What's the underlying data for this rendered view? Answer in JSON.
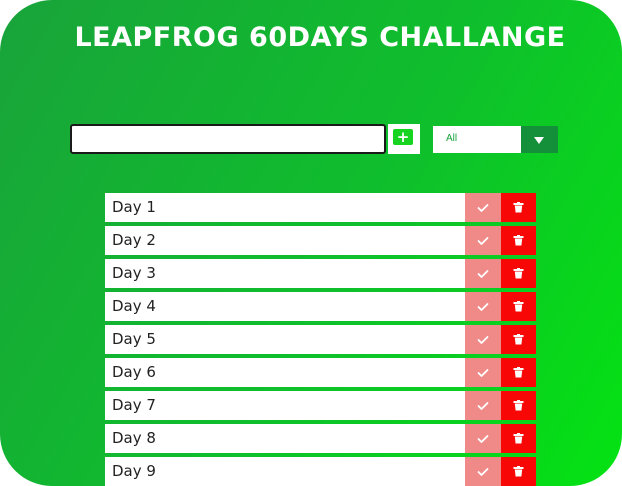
{
  "header": {
    "title": "LEAPFROG 60DAYS CHALLANGE"
  },
  "form": {
    "input_value": "",
    "add_icon": "plus-icon",
    "filter": {
      "selected": "All",
      "caret_icon": "caret-down-icon"
    }
  },
  "todos": {
    "items": [
      {
        "label": "Day 1"
      },
      {
        "label": "Day 2"
      },
      {
        "label": "Day 3"
      },
      {
        "label": "Day 4"
      },
      {
        "label": "Day 5"
      },
      {
        "label": "Day 6"
      },
      {
        "label": "Day 7"
      },
      {
        "label": "Day 8"
      },
      {
        "label": "Day 9"
      }
    ],
    "complete_icon": "check-icon",
    "delete_icon": "trash-icon"
  },
  "colors": {
    "gradient_start": "#19a33b",
    "gradient_end": "#04e312",
    "complete_button": "#ef8a88",
    "delete_button": "#f80707",
    "filter_caret": "#148f3a",
    "add_button_accent": "#16d420"
  }
}
